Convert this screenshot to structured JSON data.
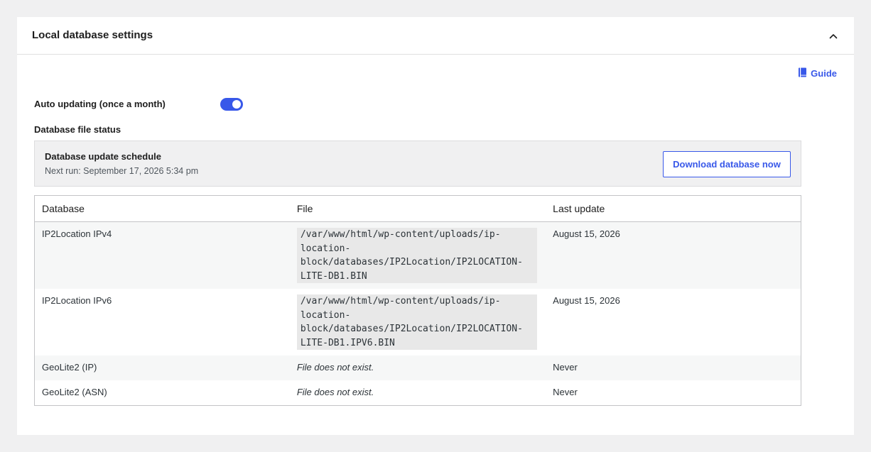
{
  "panel": {
    "title": "Local database settings",
    "collapse_icon": "chevron-up-icon"
  },
  "guide": {
    "label": "Guide",
    "icon": "book-icon",
    "color": "#3858e9"
  },
  "auto_update": {
    "label": "Auto updating (once a month)",
    "enabled": true,
    "accent": "#3858e9"
  },
  "status": {
    "label": "Database file status"
  },
  "schedule": {
    "title": "Database update schedule",
    "next_run": "Next run: September 17, 2026 5:34 pm",
    "download_label": "Download database now"
  },
  "table": {
    "headers": [
      "Database",
      "File",
      "Last update"
    ],
    "rows": [
      {
        "database": "IP2Location IPv4",
        "file": "/var/www/html/wp-content/uploads/ip-location-block/databases/IP2Location/IP2LOCATION-LITE-DB1.BIN",
        "file_lines": [
          "/var/www/html/wp-content/uploads/ip-",
          "location-",
          "block/databases/IP2Location/IP2LOCATION-",
          "LITE-DB1.BIN"
        ],
        "last_update": "August 15, 2026"
      },
      {
        "database": "IP2Location IPv6",
        "file": "/var/www/html/wp-content/uploads/ip-location-block/databases/IP2Location/IP2LOCATION-LITE-DB1.IPV6.BIN",
        "file_lines": [
          "/var/www/html/wp-content/uploads/ip-",
          "location-",
          "block/databases/IP2Location/IP2LOCATION-",
          "LITE-DB1.IPV6.BIN"
        ],
        "last_update": "August 15, 2026"
      },
      {
        "database": "GeoLite2 (IP)",
        "file": "File does not exist.",
        "last_update": "Never"
      },
      {
        "database": "GeoLite2 (ASN)",
        "file": "File does not exist.",
        "last_update": "Never"
      }
    ]
  }
}
